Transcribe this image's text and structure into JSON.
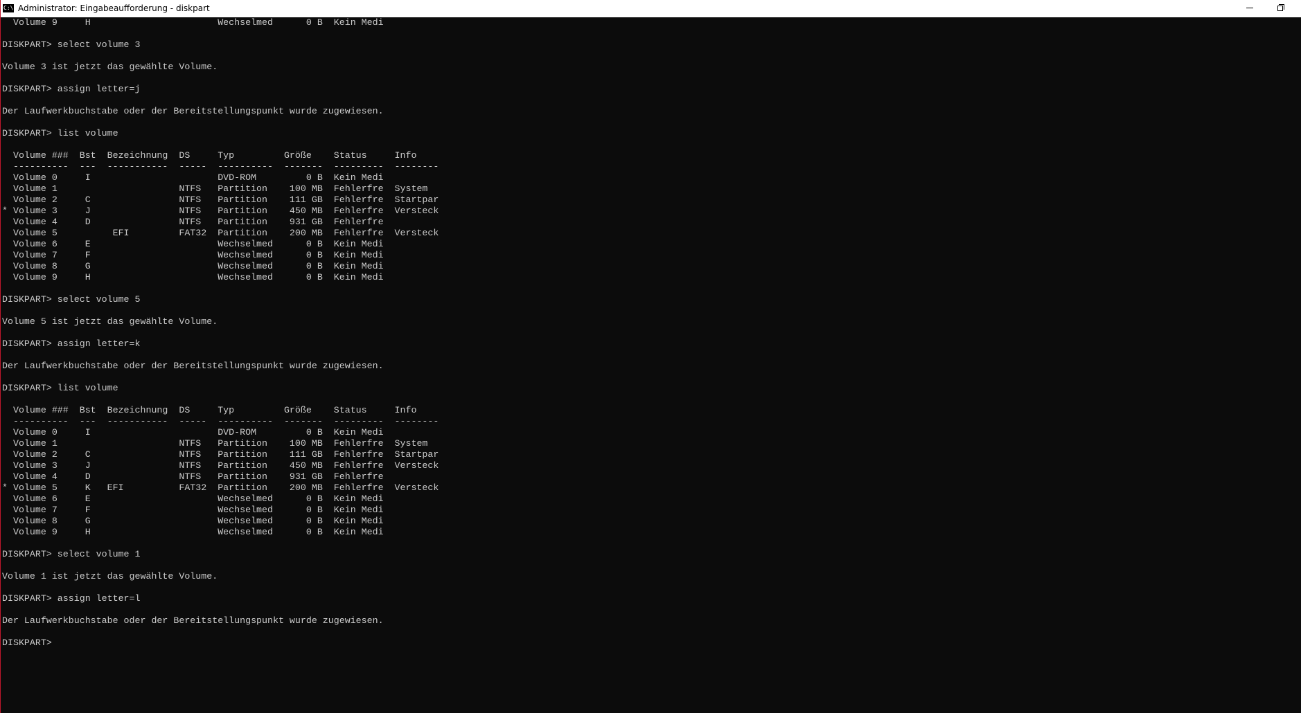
{
  "window": {
    "title": "Administrator: Eingabeaufforderung - diskpart",
    "icon_label": "C:\\",
    "minimize_icon": "minimize-icon",
    "restore_icon": "restore-icon"
  },
  "console": {
    "lines": [
      "  Volume 9     H                       Wechselmed      0 B  Kein Medi",
      "",
      "DISKPART> select volume 3",
      "",
      "Volume 3 ist jetzt das gewählte Volume.",
      "",
      "DISKPART> assign letter=j",
      "",
      "Der Laufwerkbuchstabe oder der Bereitstellungspunkt wurde zugewiesen.",
      "",
      "DISKPART> list volume",
      "",
      "  Volume ###  Bst  Bezeichnung  DS     Typ         Größe    Status     Info",
      "  ----------  ---  -----------  -----  ----------  -------  ---------  --------",
      "  Volume 0     I                       DVD-ROM         0 B  Kein Medi",
      "  Volume 1                      NTFS   Partition    100 MB  Fehlerfre  System",
      "  Volume 2     C                NTFS   Partition    111 GB  Fehlerfre  Startpar",
      "* Volume 3     J                NTFS   Partition    450 MB  Fehlerfre  Versteck",
      "  Volume 4     D                NTFS   Partition    931 GB  Fehlerfre",
      "  Volume 5          EFI         FAT32  Partition    200 MB  Fehlerfre  Versteck",
      "  Volume 6     E                       Wechselmed      0 B  Kein Medi",
      "  Volume 7     F                       Wechselmed      0 B  Kein Medi",
      "  Volume 8     G                       Wechselmed      0 B  Kein Medi",
      "  Volume 9     H                       Wechselmed      0 B  Kein Medi",
      "",
      "DISKPART> select volume 5",
      "",
      "Volume 5 ist jetzt das gewählte Volume.",
      "",
      "DISKPART> assign letter=k",
      "",
      "Der Laufwerkbuchstabe oder der Bereitstellungspunkt wurde zugewiesen.",
      "",
      "DISKPART> list volume",
      "",
      "  Volume ###  Bst  Bezeichnung  DS     Typ         Größe    Status     Info",
      "  ----------  ---  -----------  -----  ----------  -------  ---------  --------",
      "  Volume 0     I                       DVD-ROM         0 B  Kein Medi",
      "  Volume 1                      NTFS   Partition    100 MB  Fehlerfre  System",
      "  Volume 2     C                NTFS   Partition    111 GB  Fehlerfre  Startpar",
      "  Volume 3     J                NTFS   Partition    450 MB  Fehlerfre  Versteck",
      "  Volume 4     D                NTFS   Partition    931 GB  Fehlerfre",
      "* Volume 5     K   EFI          FAT32  Partition    200 MB  Fehlerfre  Versteck",
      "  Volume 6     E                       Wechselmed      0 B  Kein Medi",
      "  Volume 7     F                       Wechselmed      0 B  Kein Medi",
      "  Volume 8     G                       Wechselmed      0 B  Kein Medi",
      "  Volume 9     H                       Wechselmed      0 B  Kein Medi",
      "",
      "DISKPART> select volume 1",
      "",
      "Volume 1 ist jetzt das gewählte Volume.",
      "",
      "DISKPART> assign letter=l",
      "",
      "Der Laufwerkbuchstabe oder der Bereitstellungspunkt wurde zugewiesen.",
      "",
      "DISKPART>"
    ]
  },
  "colors": {
    "console_background": "#0c0c0c",
    "console_text": "#cccccc",
    "titlebar_background": "#ffffff",
    "window_border": "#c0182c"
  }
}
